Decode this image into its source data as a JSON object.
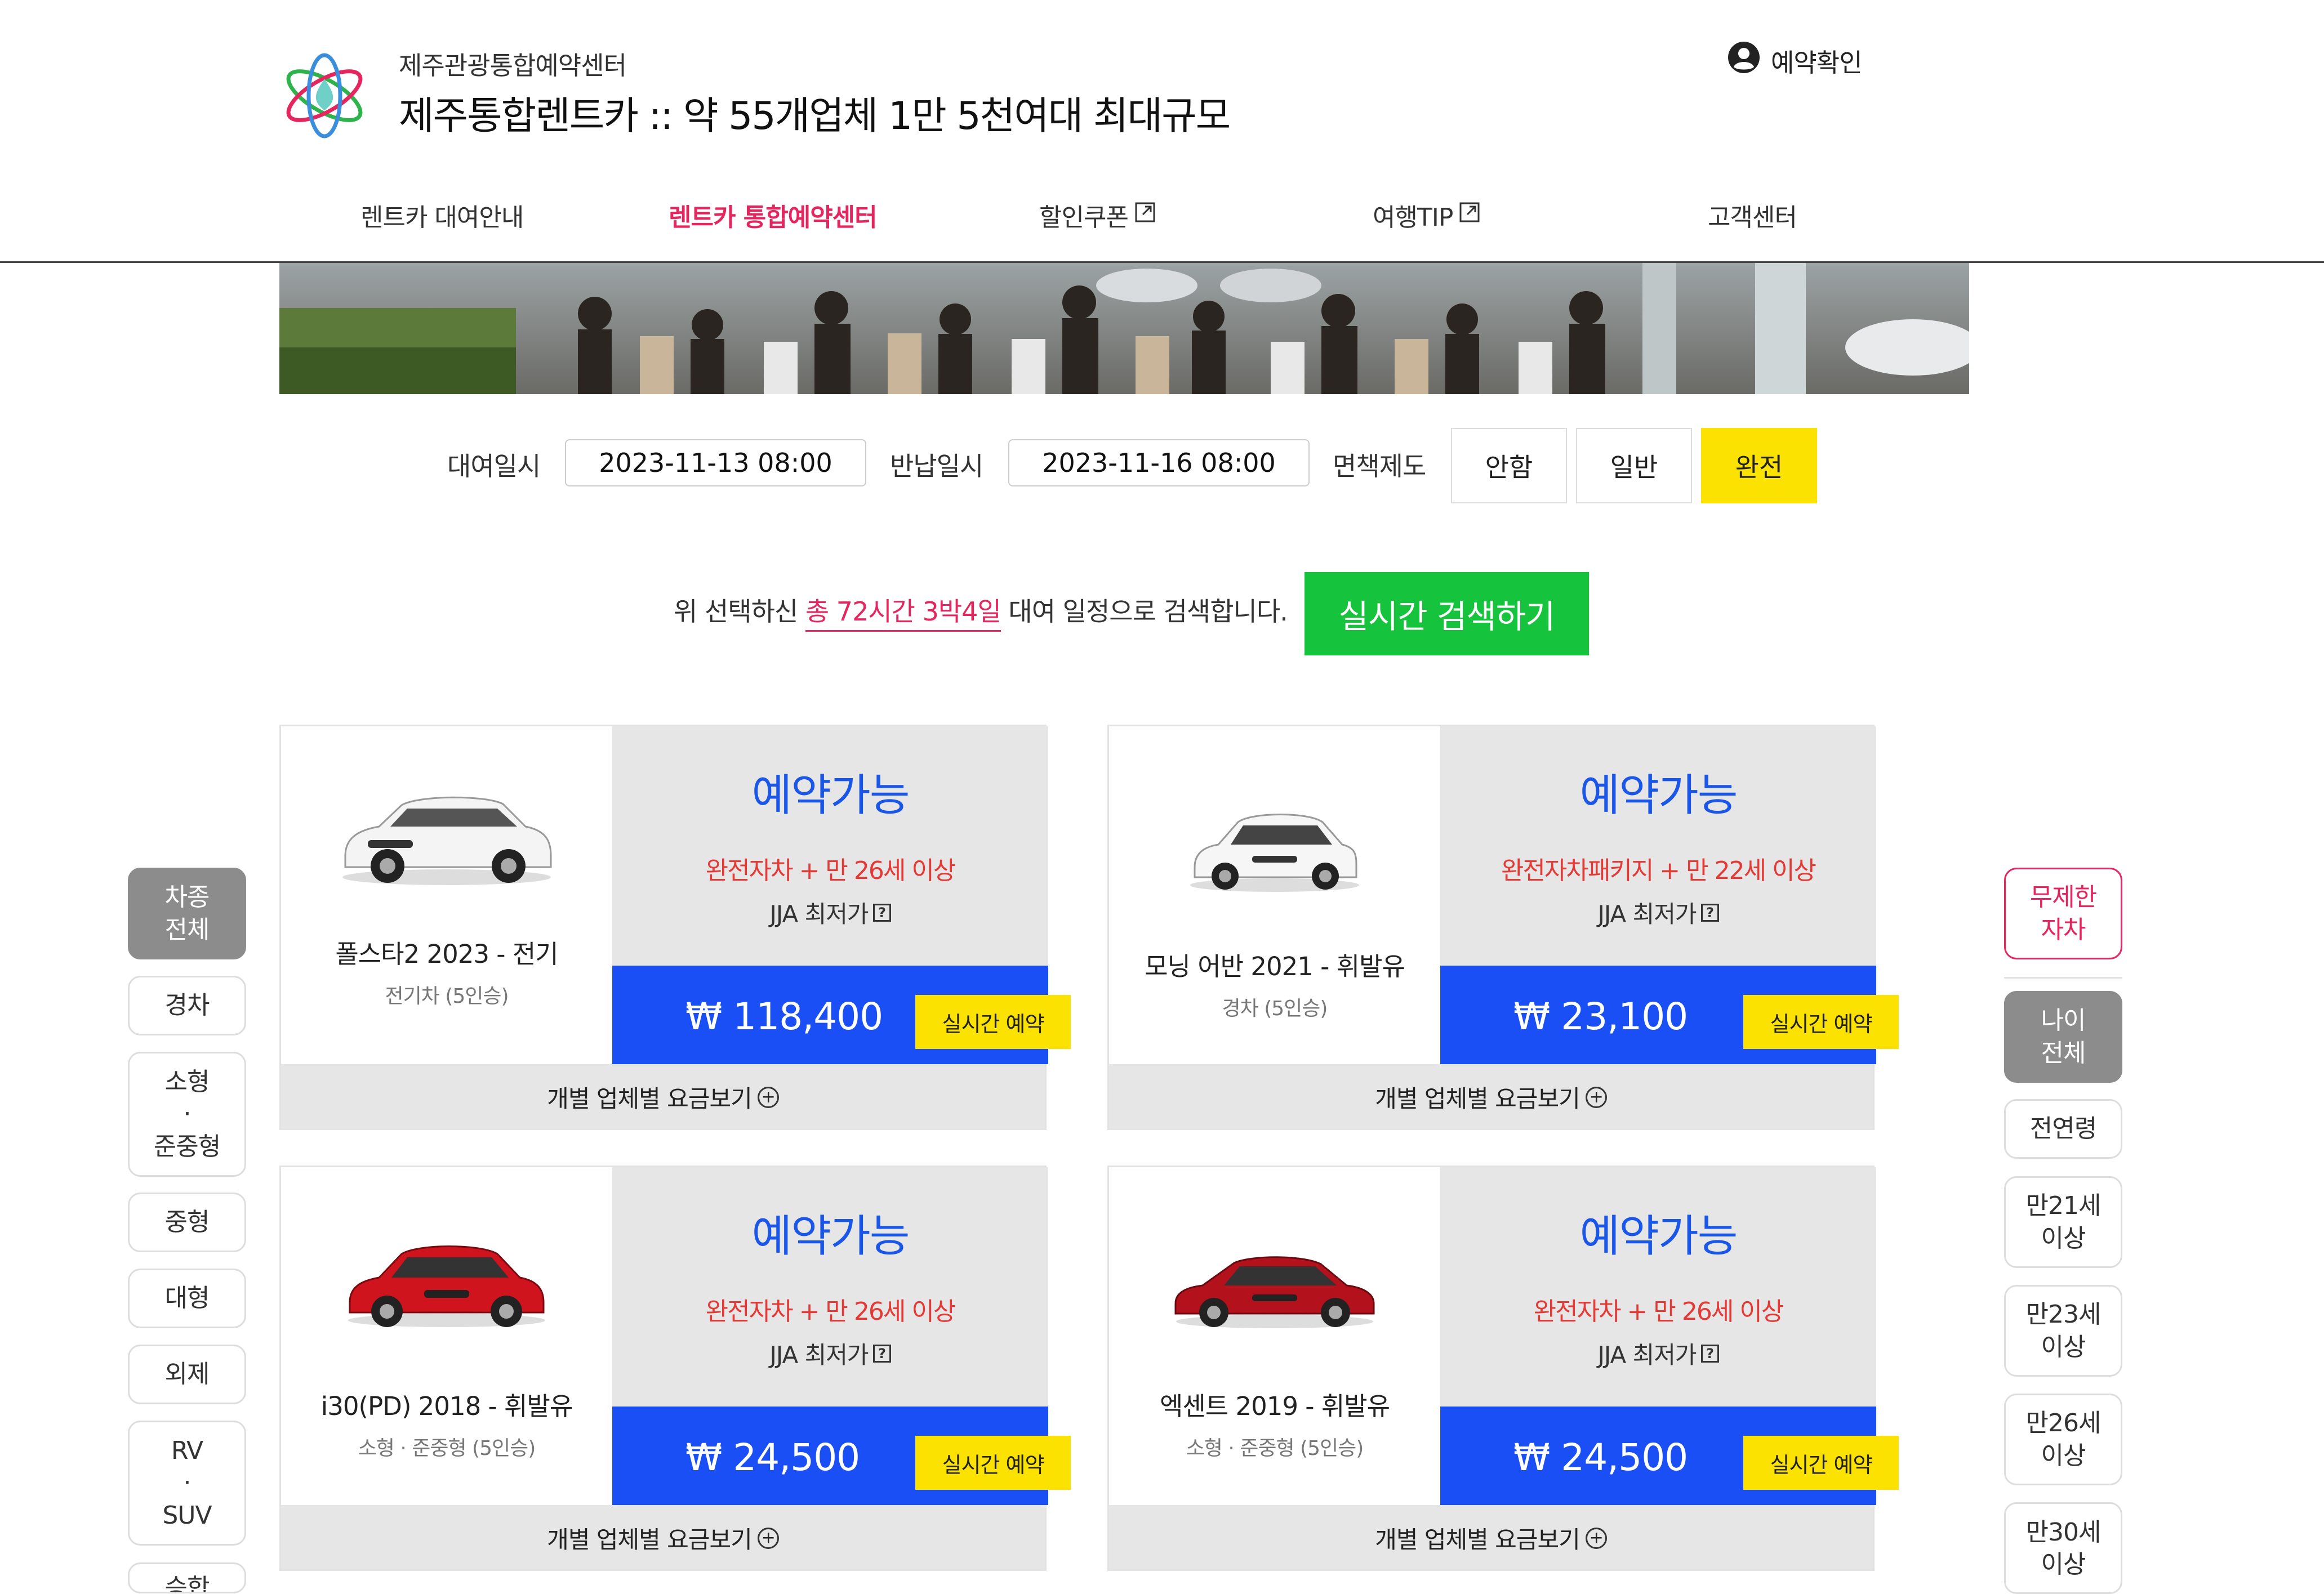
{
  "header": {
    "site_name": "제주관광통합예약센터",
    "headline": "제주통합렌트카 :: 약 55개업체 1만 5천여대 최대규모",
    "confirm_label": "예약확인"
  },
  "nav": [
    {
      "label": "렌트카 대여안내",
      "external": false
    },
    {
      "label": "렌트카 통합예약센터",
      "external": false,
      "active": true
    },
    {
      "label": "할인쿠폰",
      "external": true
    },
    {
      "label": "여행TIP",
      "external": true
    },
    {
      "label": "고객센터",
      "external": false
    }
  ],
  "search": {
    "rent_label": "대여일시",
    "rent_value": "2023-11-13 08:00",
    "return_label": "반납일시",
    "return_value": "2023-11-16 08:00",
    "insurance_label": "면책제도",
    "insurance_options": [
      "안함",
      "일반",
      "완전"
    ],
    "insurance_selected": "완전",
    "summary_pre": "위 선택하신",
    "summary_highlight": "총 72시간 3박4일",
    "summary_post": "대여 일정으로 검색합니다.",
    "search_button": "실시간 검색하기"
  },
  "cards": [
    {
      "name": "폴스타2 2023 - 전기",
      "sub": "전기차 (5인승)",
      "status": "예약가능",
      "condition": "완전자차 + 만 26세 이상",
      "lowest": "JJA 최저가",
      "price": "₩ 118,400",
      "reserve": "실시간 예약",
      "more": "개별 업체별 요금보기",
      "car_color": "#f2f2f2"
    },
    {
      "name": "모닝 어반 2021 - 휘발유",
      "sub": "경차 (5인승)",
      "status": "예약가능",
      "condition": "완전자차패키지 + 만 22세 이상",
      "lowest": "JJA 최저가",
      "price": "₩ 23,100",
      "reserve": "실시간 예약",
      "more": "개별 업체별 요금보기",
      "car_color": "#f0f0f0"
    },
    {
      "name": "i30(PD) 2018 - 휘발유",
      "sub": "소형 · 준중형 (5인승)",
      "status": "예약가능",
      "condition": "완전자차 + 만 26세 이상",
      "lowest": "JJA 최저가",
      "price": "₩ 24,500",
      "reserve": "실시간 예약",
      "more": "개별 업체별 요금보기",
      "car_color": "#d0141e"
    },
    {
      "name": "엑센트 2019 - 휘발유",
      "sub": "소형 · 준중형 (5인승)",
      "status": "예약가능",
      "condition": "완전자차 + 만 26세 이상",
      "lowest": "JJA 최저가",
      "price": "₩ 24,500",
      "reserve": "실시간 예약",
      "more": "개별 업체별 요금보기",
      "car_color": "#b3121c"
    }
  ],
  "left_filters": [
    "차종\n전체",
    "경차",
    "소형\n·\n준중형",
    "중형",
    "대형",
    "외제",
    "RV\n·\nSUV",
    "승합"
  ],
  "right_filters": {
    "top": "무제한\n자차",
    "items": [
      "나이\n전체",
      "전연령",
      "만21세\n이상",
      "만23세\n이상",
      "만26세\n이상",
      "만30세\n이상"
    ]
  },
  "colors": {
    "accent_pink": "#e5265e",
    "accent_blue": "#1a4ff5",
    "accent_green": "#16c33c",
    "accent_yellow": "#fbe200"
  }
}
